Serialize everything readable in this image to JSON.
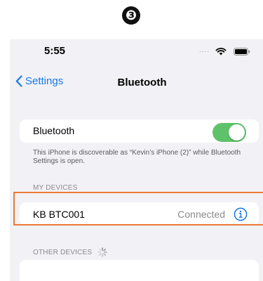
{
  "step_badge": "❸",
  "status_bar": {
    "time": "5:55",
    "signal_dots": "....",
    "icons": [
      "wifi-icon",
      "battery-icon"
    ]
  },
  "nav": {
    "back_label": "Settings",
    "title": "Bluetooth"
  },
  "bluetooth": {
    "label": "Bluetooth",
    "enabled": true,
    "footnote": "This iPhone is discoverable as “Kevin’s iPhone (2)” while Bluetooth Settings is open."
  },
  "my_devices": {
    "header": "MY DEVICES",
    "items": [
      {
        "name": "KB BTC001",
        "status": "Connected"
      }
    ]
  },
  "other_devices": {
    "header": "OTHER DEVICES"
  },
  "colors": {
    "accent": "#1677e6",
    "toggle_on": "#5ec26a",
    "highlight": "#ec7a35"
  }
}
